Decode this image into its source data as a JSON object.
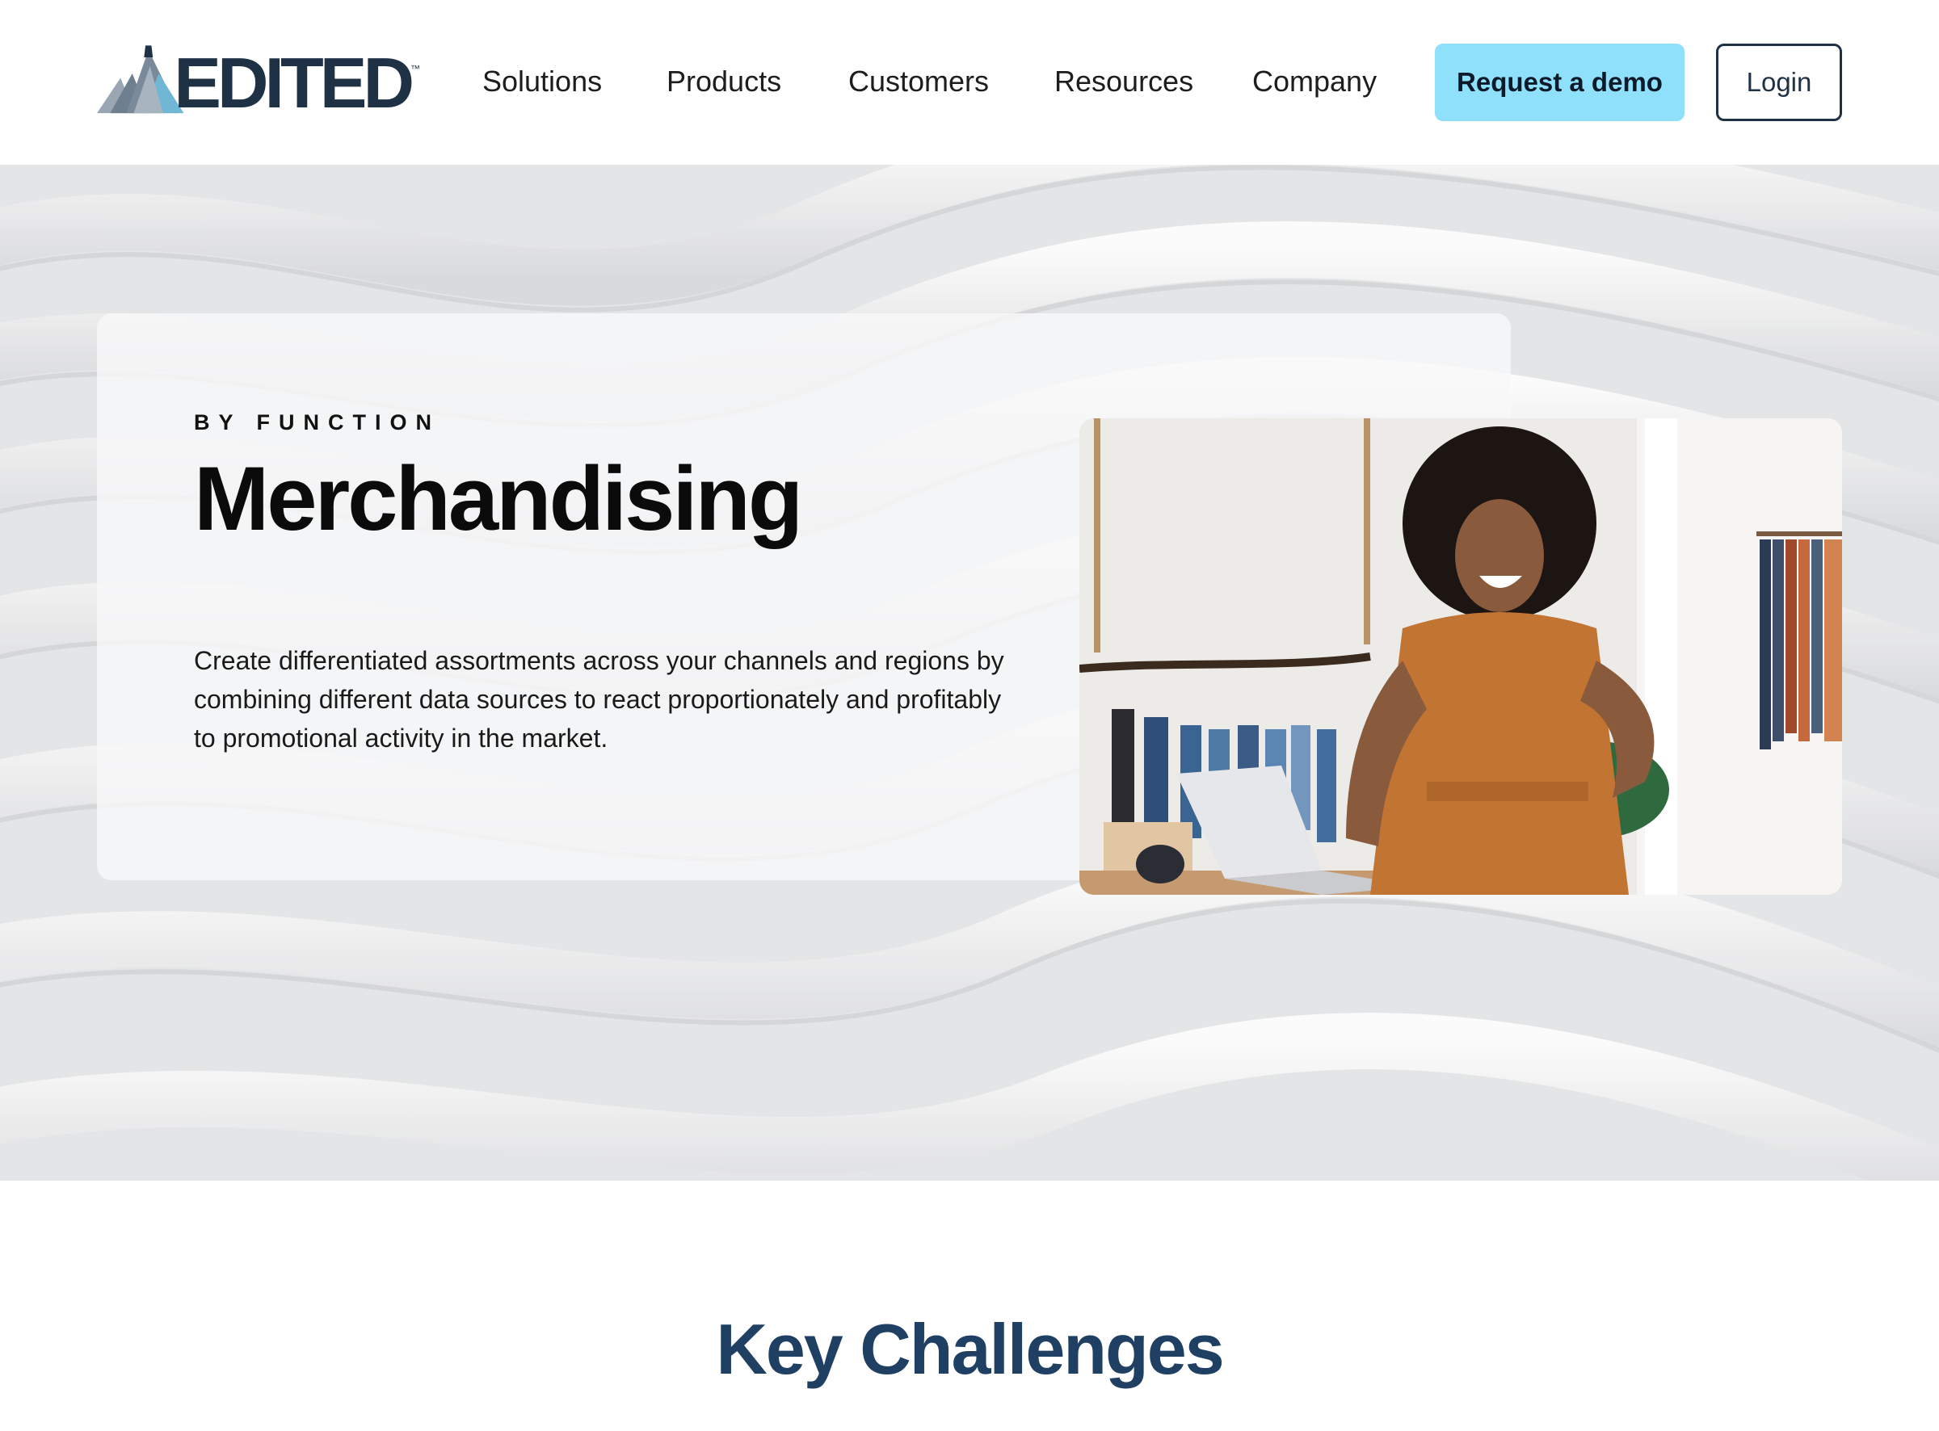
{
  "brand": {
    "name": "EDITED",
    "trademark": "™",
    "logo_icon": "mountain-logo-icon",
    "colors": {
      "dark": "#1f3145",
      "accent": "#8ee0fb",
      "heading_blue": "#1f3f63"
    }
  },
  "nav": {
    "items": [
      {
        "label": "Solutions"
      },
      {
        "label": "Products"
      },
      {
        "label": "Customers"
      },
      {
        "label": "Resources"
      },
      {
        "label": "Company"
      }
    ],
    "demo_button": "Request a demo",
    "login_button": "Login"
  },
  "hero": {
    "eyebrow": "BY FUNCTION",
    "title": "Merchandising",
    "description": "Create differentiated assortments across your channels and regions by combining different data sources to react proportionately and profitably to promotional activity in the market.",
    "photo": "smiling-woman-in-clothing-store-with-laptop"
  },
  "section": {
    "title": "Key Challenges"
  }
}
